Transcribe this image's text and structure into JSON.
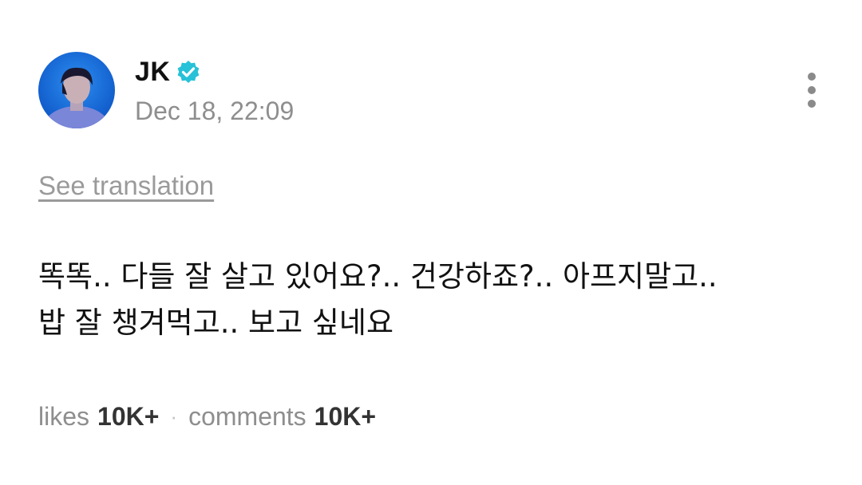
{
  "post": {
    "author": "JK",
    "verified_icon": "verified-badge-icon",
    "timestamp": "Dec 18, 22:09",
    "see_translation_label": "See translation",
    "body": "똑똑.. 다들 잘 살고 있어요?.. 건강하죠?.. 아프지말고..\n밥 잘 챙겨먹고.. 보고 싶네요",
    "more_icon": "more-vertical-icon"
  },
  "stats": {
    "likes_label": "likes",
    "likes_value": "10K+",
    "separator": "·",
    "comments_label": "comments",
    "comments_value": "10K+"
  },
  "colors": {
    "verified": "#27c1d8",
    "text_primary": "#111111",
    "text_secondary": "#8e8e8e"
  }
}
